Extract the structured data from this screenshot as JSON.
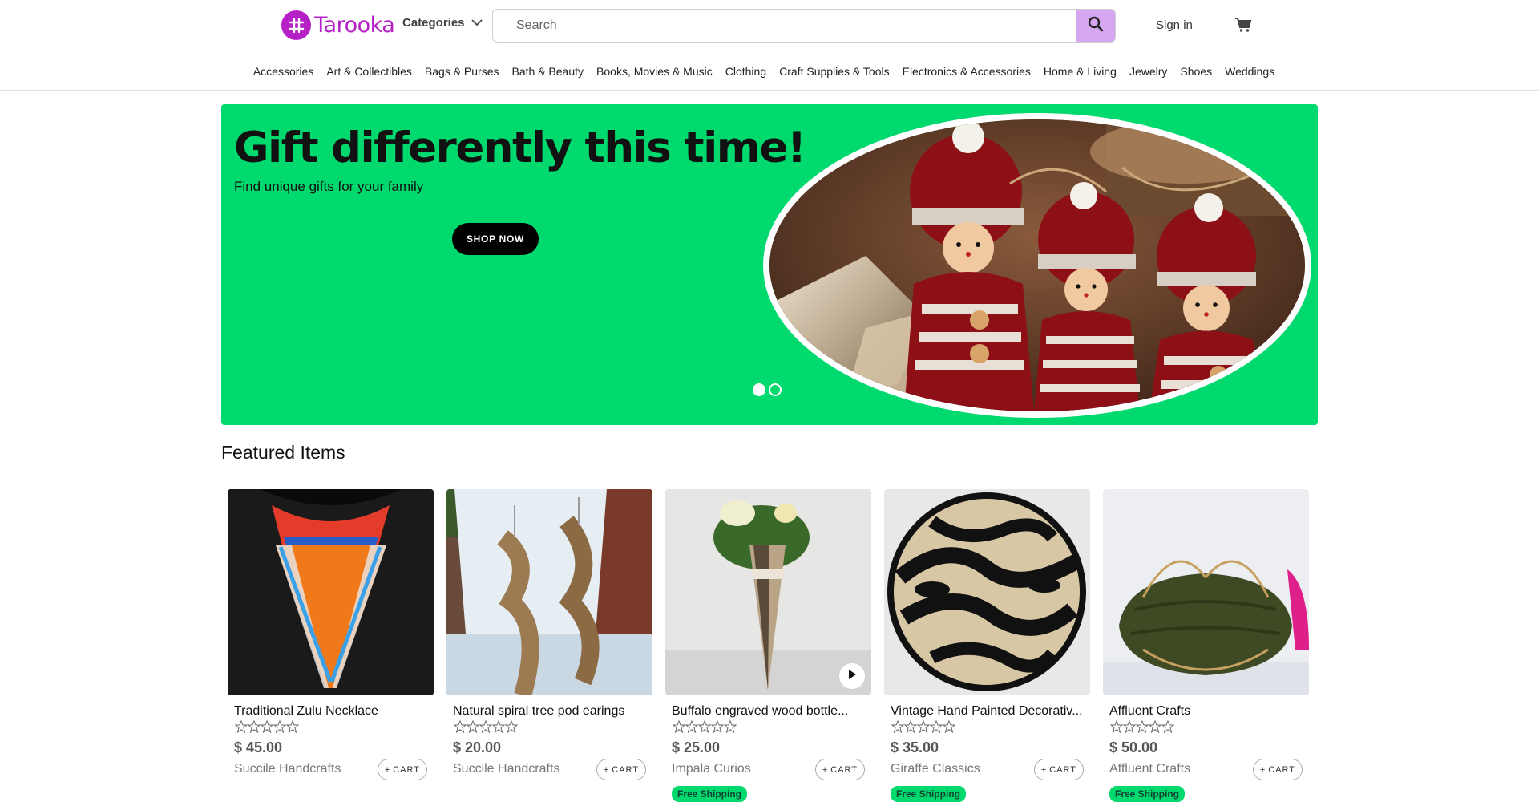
{
  "header": {
    "brand": "Tarooka",
    "categories_label": "Categories",
    "search_placeholder": "Search",
    "signin_label": "Sign in",
    "icons": [
      "logo-icon",
      "chevron-down-icon",
      "search-icon",
      "cart-icon"
    ]
  },
  "nav": {
    "categories": [
      "Accessories",
      "Art & Collectibles",
      "Bags & Purses",
      "Bath & Beauty",
      "Books, Movies & Music",
      "Clothing",
      "Craft Supplies & Tools",
      "Electronics & Accessories",
      "Home & Living",
      "Jewelry",
      "Shoes",
      "Weddings"
    ]
  },
  "hero": {
    "title": "Gift differently this time!",
    "subtitle": "Find unique gifts for your family",
    "button_label": "SHOP NOW",
    "background_color": "#00d96d"
  },
  "featured": {
    "title": "Featured Items",
    "products": [
      {
        "title": "Traditional Zulu Necklace",
        "price": "$ 45.00",
        "seller": "Succile Handcrafts",
        "cart_label": "CART",
        "badge": ""
      },
      {
        "title": "Natural spiral tree pod earings",
        "price": "$ 20.00",
        "seller": "Succile Handcrafts",
        "cart_label": "CART",
        "badge": ""
      },
      {
        "title": "Buffalo engraved wood bottle...",
        "price": "$ 25.00",
        "seller": "Impala Curios",
        "cart_label": "CART",
        "badge": "Free Shipping"
      },
      {
        "title": "Vintage Hand Painted Decorativ...",
        "price": "$ 35.00",
        "seller": "Giraffe Classics",
        "cart_label": "CART",
        "badge": "Free Shipping"
      },
      {
        "title": "Affluent Crafts",
        "price": "$ 50.00",
        "seller": "Affluent Crafts",
        "cart_label": "CART",
        "badge": "Free Shipping"
      }
    ]
  }
}
